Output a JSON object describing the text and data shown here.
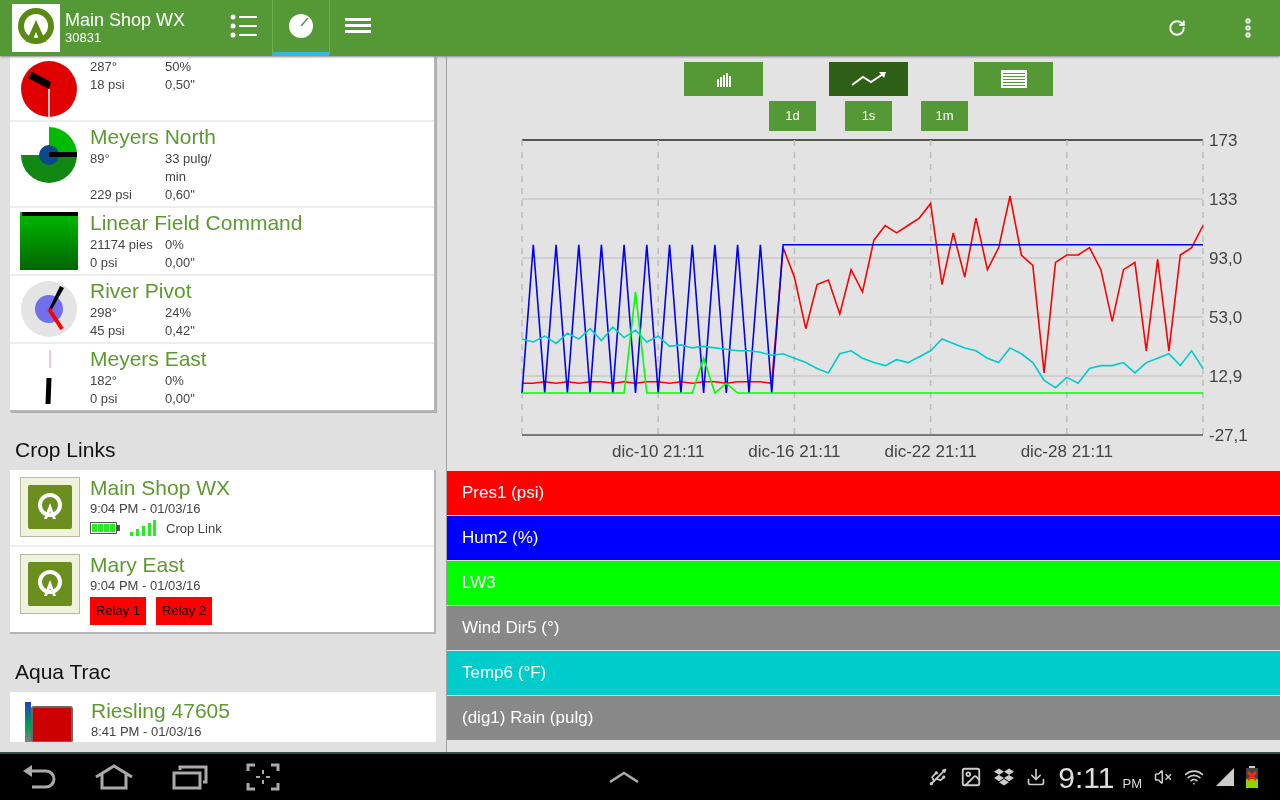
{
  "header": {
    "title": "Main Shop WX",
    "subtitle": "30831",
    "tabs": [
      {
        "kind": "list",
        "selected": false
      },
      {
        "kind": "gauge",
        "selected": true
      },
      {
        "kind": "menu",
        "selected": false
      }
    ]
  },
  "pivots": [
    {
      "kind": "pivot",
      "stats": [
        [
          "287°",
          "50%"
        ],
        [
          "18 psi",
          "0,50\""
        ]
      ]
    },
    {
      "kind": "pivot",
      "name": "Meyers North",
      "stats": [
        [
          "89°",
          "33 pulg/ min"
        ],
        [
          "229 psi",
          "0,60\""
        ]
      ]
    },
    {
      "kind": "linear",
      "name": "Linear Field Command",
      "stats": [
        [
          "21174  pies",
          "0%"
        ],
        [
          "0 psi",
          "0,00\""
        ]
      ]
    },
    {
      "kind": "pivot",
      "name": "River Pivot",
      "stats": [
        [
          "298°",
          "24%"
        ],
        [
          "45 psi",
          "0,42\""
        ]
      ]
    },
    {
      "kind": "pivot",
      "name": "Meyers East",
      "stats": [
        [
          "182°",
          "0%"
        ],
        [
          "0 psi",
          "0,00\""
        ]
      ]
    }
  ],
  "crop_links": {
    "title": "Crop Links",
    "items": [
      {
        "name": "Main Shop WX",
        "time": "9:04 PM - 01/03/16",
        "link_label": "Crop Link"
      },
      {
        "name": "Mary East",
        "time": "9:04 PM - 01/03/16",
        "relays": [
          "Relay 1",
          "Relay 2"
        ]
      }
    ]
  },
  "aqua_trac": {
    "title": "Aqua Trac",
    "items": [
      {
        "name": "Riesling 47605",
        "time": "8:41 PM - 01/03/16"
      }
    ]
  },
  "chart_modes": [
    {
      "kind": "bar",
      "selected": false
    },
    {
      "kind": "line",
      "selected": true
    },
    {
      "kind": "table",
      "selected": false
    }
  ],
  "ranges": [
    "1d",
    "1s",
    "1m"
  ],
  "chart_data": {
    "type": "line",
    "grid": true,
    "ylim": [
      -27.1,
      173
    ],
    "categories": [
      null,
      null,
      null,
      null,
      null,
      null,
      null,
      null,
      null,
      null,
      null,
      null,
      "dic-10 21:11",
      null,
      null,
      null,
      null,
      null,
      null,
      null,
      null,
      null,
      null,
      null,
      "dic-16 21:11",
      null,
      null,
      null,
      null,
      null,
      null,
      null,
      null,
      null,
      null,
      null,
      "dic-22 21:11",
      null,
      null,
      null,
      null,
      null,
      null,
      null,
      null,
      null,
      null,
      null,
      "dic-28 21:11",
      null,
      null,
      null,
      null,
      null,
      null,
      null,
      null,
      null,
      null,
      null,
      null
    ],
    "yticks": [
      {
        "value": 173,
        "label": "173"
      },
      {
        "value": 133,
        "label": "133"
      },
      {
        "value": 93,
        "label": "93,0"
      },
      {
        "value": 53,
        "label": "53,0"
      },
      {
        "value": 12.9,
        "label": "12,9"
      },
      {
        "value": -27.1,
        "label": "-27,1"
      }
    ],
    "series": [
      {
        "name": "Pres1 (psi)",
        "color": "#ff0000",
        "values": [
          8,
          8,
          9,
          8,
          9,
          8,
          9,
          9,
          8,
          9,
          8,
          9,
          9,
          8,
          9,
          8,
          9,
          9,
          8,
          9,
          9,
          9,
          8,
          100,
          80,
          45,
          75,
          78,
          55,
          85,
          70,
          105,
          115,
          110,
          115,
          120,
          130,
          75,
          110,
          80,
          120,
          85,
          100,
          135,
          95,
          88,
          15,
          90,
          95,
          95,
          100,
          85,
          50,
          85,
          90,
          30,
          92,
          30,
          95,
          100,
          115
        ]
      },
      {
        "name": "Hum2 (%)",
        "color": "#0000ff",
        "values": [
          1.4,
          102,
          1.4,
          102,
          1.4,
          102,
          1.4,
          102,
          1.4,
          102,
          1.4,
          102,
          1.4,
          102,
          1.4,
          102,
          1.4,
          102,
          1.4,
          102,
          1.4,
          102,
          1.4,
          102,
          102,
          102,
          102,
          102,
          102,
          102,
          102,
          102,
          102,
          102,
          102,
          102,
          102,
          102,
          102,
          102,
          102,
          102,
          102,
          102,
          102,
          102,
          102,
          102,
          102,
          102,
          102,
          102,
          102,
          102,
          102,
          102,
          102,
          102,
          102,
          102,
          102
        ]
      },
      {
        "name": "LW3",
        "color": "#00ff00",
        "values": [
          1.4,
          1.4,
          1.4,
          1.4,
          1.4,
          1.4,
          1.4,
          1.4,
          1.4,
          1.4,
          70,
          1.4,
          1.4,
          1.4,
          1.4,
          1.4,
          25,
          1.4,
          8,
          1.4,
          1.4,
          1.4,
          1.4,
          1.4,
          1.4,
          1.4,
          1.4,
          1.4,
          1.4,
          1.4,
          1.4,
          1.4,
          1.4,
          1.4,
          1.4,
          1.4,
          1.4,
          1.4,
          1.4,
          1.4,
          1.4,
          1.4,
          1.4,
          1.4,
          1.4,
          1.4,
          1.4,
          1.4,
          1.4,
          1.4,
          1.4,
          1.4,
          1.4,
          1.4,
          1.4,
          1.4,
          1.4,
          1.4,
          1.4,
          1.4,
          1.4
        ]
      },
      {
        "name": "Wind Dir5 (°)",
        "color": "#888888",
        "values": [
          null,
          null,
          null,
          null,
          null,
          null,
          null,
          null,
          null,
          null,
          null,
          null,
          null,
          null,
          null,
          null,
          null,
          null,
          null,
          null,
          null,
          null,
          null,
          null,
          null,
          null,
          null,
          null,
          null,
          null,
          null,
          null,
          null,
          null,
          null,
          null,
          null,
          null,
          null,
          null,
          null,
          null,
          null,
          null,
          null,
          null,
          null,
          null,
          null,
          null,
          null,
          null,
          null,
          null,
          null,
          null,
          null,
          null,
          null,
          null,
          null
        ]
      },
      {
        "name": "Temp6 (°F)",
        "color": "#00cccc",
        "values": [
          38,
          36,
          40,
          35,
          42,
          38,
          45,
          37,
          46,
          39,
          44,
          36,
          40,
          33,
          34,
          32,
          33,
          32,
          31,
          30,
          30,
          29,
          27,
          28,
          25,
          22,
          18,
          15,
          28,
          30,
          25,
          22,
          20,
          24,
          22,
          26,
          30,
          38,
          35,
          32,
          30,
          25,
          22,
          32,
          28,
          22,
          10,
          5,
          12,
          8,
          18,
          20,
          20,
          22,
          15,
          22,
          25,
          28,
          20,
          30,
          18
        ]
      },
      {
        "name": "(dig1) Rain (pulg)",
        "color": "#888888",
        "values": [
          null,
          null,
          null,
          null,
          null,
          null,
          null,
          null,
          null,
          null,
          null,
          null,
          null,
          null,
          null,
          null,
          null,
          null,
          null,
          null,
          null,
          null,
          null,
          null,
          null,
          null,
          null,
          null,
          null,
          null,
          null,
          null,
          null,
          null,
          null,
          null,
          null,
          null,
          null,
          null,
          null,
          null,
          null,
          null,
          null,
          null,
          null,
          null,
          null,
          null,
          null,
          null,
          null,
          null,
          null,
          null,
          null,
          null,
          null,
          null,
          null
        ]
      }
    ]
  },
  "system_bar": {
    "time": "9:11",
    "ampm": "PM"
  }
}
